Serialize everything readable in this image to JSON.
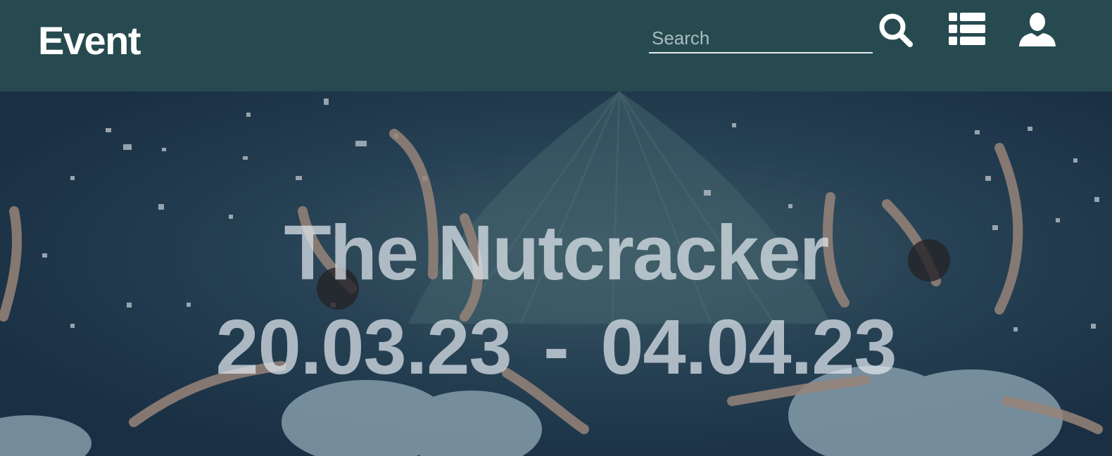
{
  "header": {
    "brand": "Event",
    "search": {
      "placeholder": "Search",
      "value": ""
    },
    "icons": [
      "search-icon",
      "list-icon",
      "user-icon"
    ]
  },
  "hero": {
    "title": "The Nutcracker",
    "dates": "20.03.23 - 04.04.23"
  },
  "colors": {
    "header_bg": "#264a4f",
    "header_text": "#ffffff",
    "hero_text": "#e1e8ee"
  }
}
